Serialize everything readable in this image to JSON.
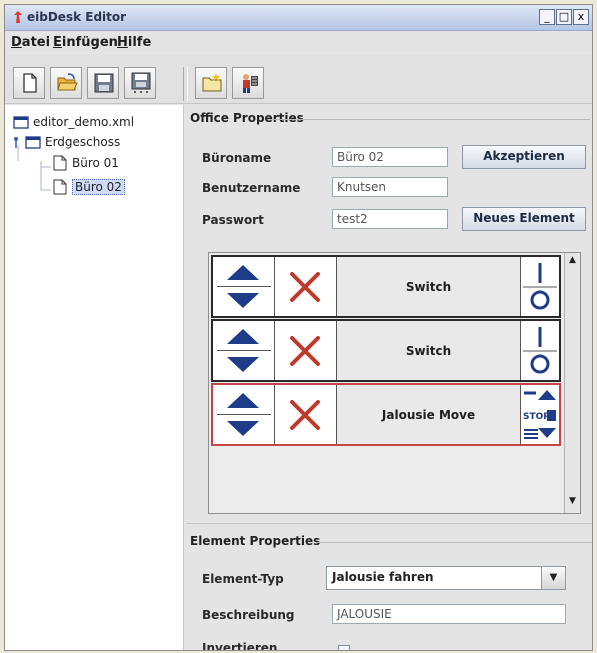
{
  "window": {
    "title": "eibDesk Editor",
    "controls": {
      "minimize": "_",
      "maximize": "□",
      "close": "x"
    }
  },
  "menu": [
    {
      "underline": "D",
      "rest": "atei"
    },
    {
      "underline": "E",
      "rest": "infügen"
    },
    {
      "underline": "H",
      "rest": "ilfe"
    }
  ],
  "toolbar_icons": [
    "new-file-icon",
    "open-folder-icon",
    "save-icon",
    "save-all-icon",
    "new-folder-icon",
    "add-element-icon"
  ],
  "tree": {
    "root": "editor_demo.xml",
    "floor": "Erdgeschoss",
    "offices": [
      "Büro 01",
      "Büro 02"
    ],
    "selected": "Büro 02"
  },
  "office_properties": {
    "title": "Office Properties",
    "buroname_label": "Büroname",
    "buroname_value": "Büro 02",
    "benutzer_label": "Benutzername",
    "benutzer_value": "Knutsen",
    "passwort_label": "Passwort",
    "passwort_value": "test2",
    "accept_button": "Akzeptieren",
    "new_element_button": "Neues Element"
  },
  "elements": [
    {
      "name": "Switch",
      "icon": "switch-icon"
    },
    {
      "name": "Switch",
      "icon": "switch-icon"
    },
    {
      "name": "Jalousie Move",
      "icon": "jalousie-icon"
    }
  ],
  "jalousie_stop": "STOP",
  "element_properties": {
    "title": "Element Properties",
    "type_label": "Element-Typ",
    "type_value": "Jalousie fahren",
    "desc_label": "Beschreibung",
    "desc_value": "JALOUSIE",
    "invert_label": "Invertieren"
  },
  "colors": {
    "accent_blue": "#1f3c88",
    "delete_red": "#c0392b",
    "selected_row_border": "#c64545"
  }
}
